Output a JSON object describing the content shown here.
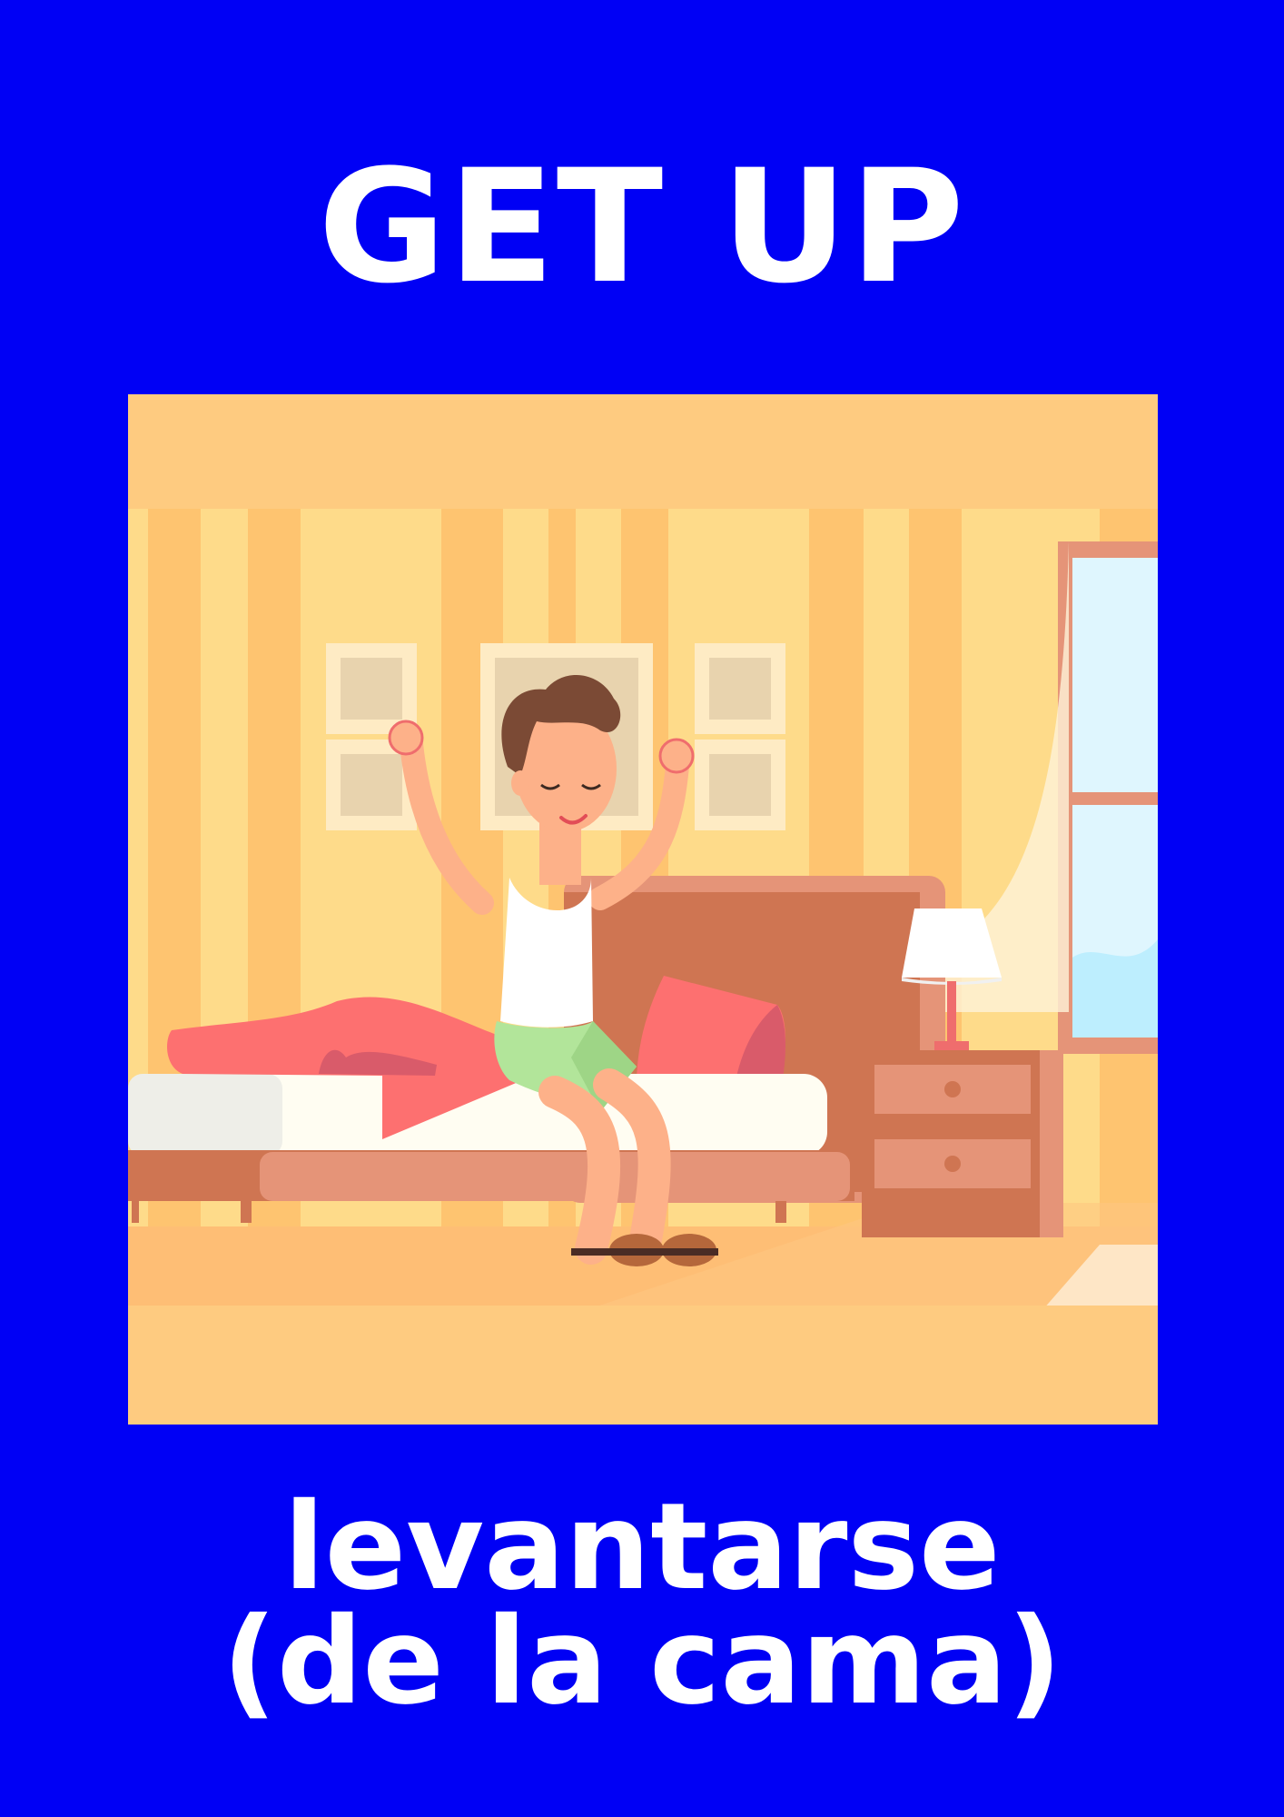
{
  "card": {
    "title": "GET UP",
    "caption_line_1": "levantarse",
    "caption_line_2": "(de la cama)"
  },
  "colors": {
    "background": "#0000f5",
    "text": "#ffffff",
    "frame_band": "#fecb80",
    "wall_light": "#fedb8a",
    "wall_stripe": "#fec470",
    "bed_frame": "#e59478",
    "blanket": "#fd7070"
  }
}
